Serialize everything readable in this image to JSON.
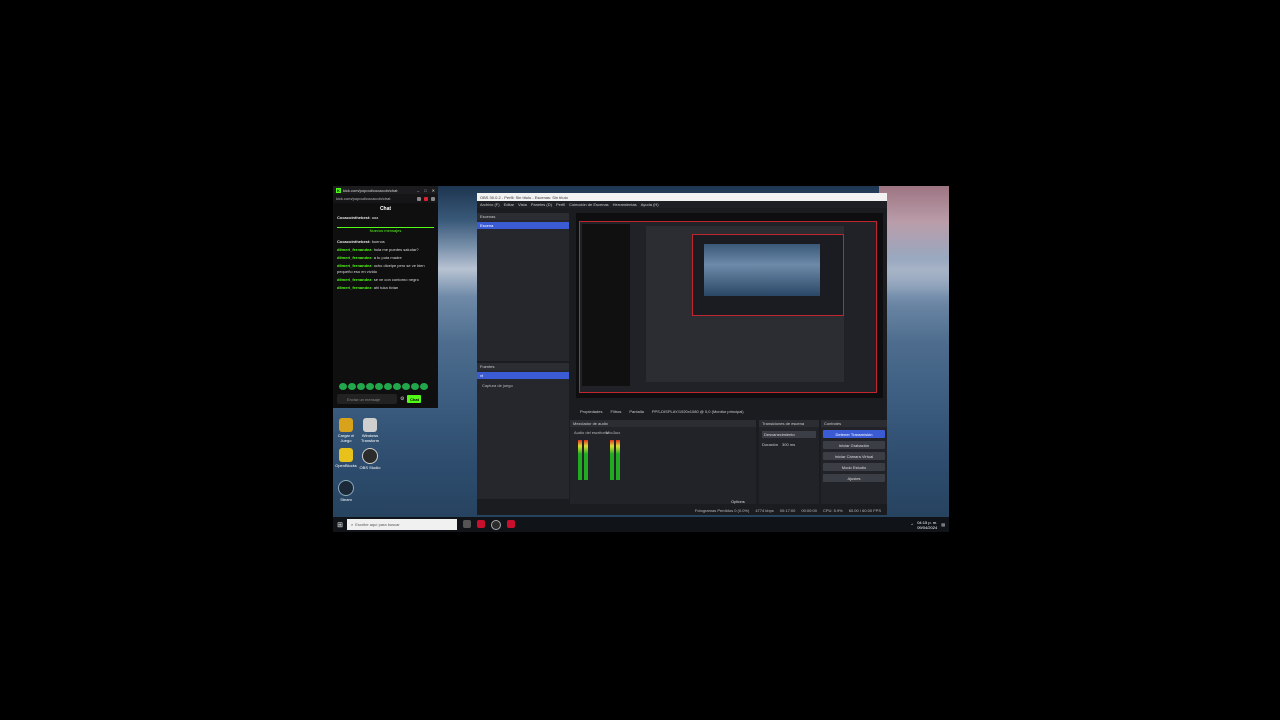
{
  "chat_window": {
    "url": "kick.com/popout/cocacoin/chat",
    "title": "Chat",
    "messages_before": [
      {
        "user": "Cocacointhebest:",
        "text": "aaa"
      }
    ],
    "new_messages_label": "Nuevos mensajes",
    "messages_after": [
      {
        "user": "Cocacointhebest:",
        "text": "buenos",
        "white": true
      },
      {
        "user": "dilmeri_fernandez:",
        "text": "hola me puedes saludar?"
      },
      {
        "user": "dilmeri_fernandez:",
        "text": "a tu puta madre"
      },
      {
        "user": "dilmeri_fernandez:",
        "text": "ocho dicelpe pero se ve bien pequeño eso en vivido"
      },
      {
        "user": "dilmeri_fernandez:",
        "text": "se ve con contorno negro"
      },
      {
        "user": "dilmeri_fernandez:",
        "text": "ahi tuka tivian"
      }
    ],
    "input_placeholder": "Enviar un mensaje",
    "send_label": "Chat"
  },
  "desktop_icons": [
    {
      "label": "Cargar el Juego",
      "color": "#d9a21b"
    },
    {
      "label": "Windows Transform",
      "color": "#cfcfcf"
    },
    {
      "label": "OpenBlocks",
      "color": "#e8c21a"
    },
    {
      "label": "OBS Studio",
      "color": "#2b2b2b"
    },
    {
      "label": "Steam",
      "color": "#1b2838"
    }
  ],
  "obs": {
    "title": "OBS 30.0.2 - Perfil: Sin título - Escenas: Sin título",
    "menu": [
      "Archivo (F)",
      "Editar",
      "Vista",
      "Paneles (D)",
      "Perfil",
      "Colección de Escenas",
      "Herramientas",
      "Ayuda (H)"
    ],
    "scenes_header": "Escenas",
    "scene_selected": "Escena",
    "sources_header": "Fuentes",
    "sources": [
      "vt",
      "Captura de juego"
    ],
    "preview_tabs": [
      "Propiedades",
      "Filtros",
      "Pantalla"
    ],
    "display_value": "PPS-DISPLAY/1920x1080 @ 0,0 (Monitor principal)",
    "audio_header": "Mezclador de audio",
    "audio_channels": [
      "Audio del escritorio",
      "Mic/Aux"
    ],
    "transitions_header": "Transiciones de escena",
    "transition_value": "Desvanecimiento",
    "duration_label": "Duración",
    "duration_value": "300 ms",
    "controls_header": "Controles",
    "controls": [
      "Detener Transmisión",
      "Iniciar Grabación",
      "Iniciar Cámara Virtual",
      "Modo Estudio",
      "Ajustes"
    ],
    "options_label": "Options",
    "status": [
      "Fotogramas Perdidos 0 (0.0%)",
      "4774 kbps",
      "00:17:00",
      "00:00:00",
      "CPU: 5.9%",
      "60.00 / 60.00 FPS"
    ]
  },
  "taskbar": {
    "search_placeholder": "Escribe aquí para buscar",
    "time": "04:15 p. m.",
    "date": "09/04/2024"
  }
}
